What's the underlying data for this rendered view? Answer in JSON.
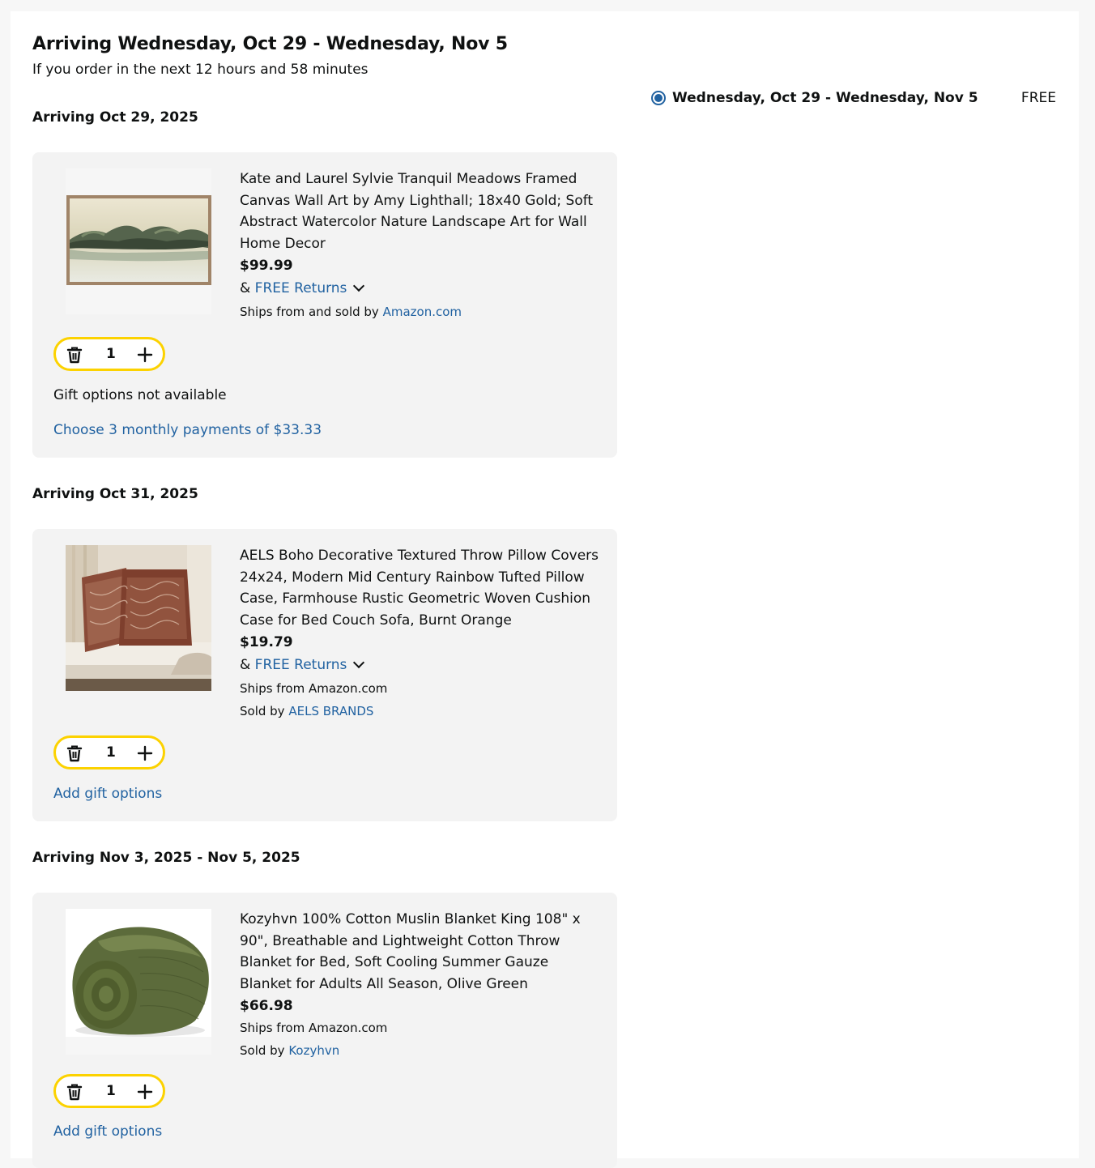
{
  "delivery": {
    "title": "Arriving Wednesday, Oct 29 - Wednesday, Nov 5",
    "subtitle": "If you order in the next 12 hours and 58 minutes",
    "option": {
      "label": "Wednesday, Oct 29 - Wednesday, Nov 5",
      "price": "FREE",
      "selected": true
    }
  },
  "groups": [
    {
      "date": "Arriving Oct 29, 2025",
      "item": {
        "title": "Kate and Laurel Sylvie Tranquil Meadows Framed Canvas Wall Art by Amy Lighthall; 18x40 Gold; Soft Abstract Watercolor Nature Landscape Art for Wall Home Decor",
        "price": "$99.99",
        "returns_prefix": "&",
        "returns_link": "FREE Returns",
        "ships_line": "Ships from and sold by",
        "ships_link": "Amazon.com",
        "quantity": "1",
        "gift": "Gift options not available",
        "action_link": "Choose 3 monthly payments of $33.33",
        "image": "framed-landscape-art"
      }
    },
    {
      "date": "Arriving Oct 31, 2025",
      "item": {
        "title": "AELS Boho Decorative Textured Throw Pillow Covers 24x24, Modern Mid Century Rainbow Tufted Pillow Case, Farmhouse Rustic Geometric Woven Cushion Case for Bed Couch Sofa, Burnt Orange",
        "price": "$19.79",
        "returns_prefix": "&",
        "returns_link": "FREE Returns",
        "ships_line": "Ships from Amazon.com",
        "sold_by": "Sold by",
        "seller_link": "AELS BRANDS",
        "quantity": "1",
        "action_link": "Add gift options",
        "image": "throw-pillows-on-sofa"
      }
    },
    {
      "date": "Arriving Nov 3, 2025 - Nov 5, 2025",
      "item": {
        "title": "Kozyhvn 100% Cotton Muslin Blanket King 108\" x 90\", Breathable and Lightweight Cotton Throw Blanket for Bed, Soft Cooling Summer Gauze Blanket for Adults All Season, Olive Green",
        "price": "$66.98",
        "ships_line": "Ships from Amazon.com",
        "sold_by": "Sold by",
        "seller_link": "Kozyhvn",
        "quantity": "1",
        "action_link": "Add gift options",
        "image": "rolled-olive-blanket"
      }
    }
  ],
  "colors": {
    "link": "#2162a1",
    "card_bg": "#f3f3f3",
    "qty_border": "#fcd200",
    "radio": "#2162a1"
  }
}
